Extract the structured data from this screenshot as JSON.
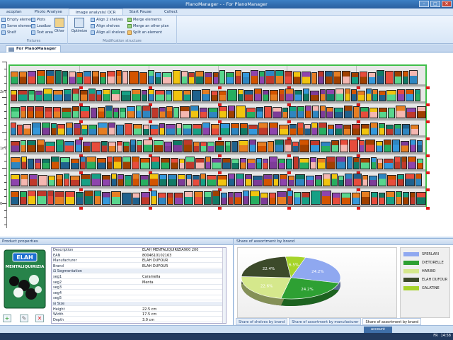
{
  "window": {
    "title": "PlanoManager - - For PlanoManager",
    "btn_min": "–",
    "btn_max": "□",
    "btn_close": "✕"
  },
  "menu_tabs": [
    "acoplan",
    "Photo Analyse",
    "Image analysis/ OCR",
    "Start Pause",
    "Collect"
  ],
  "ribbon": {
    "fixtures": {
      "empty_element": "Empty element",
      "same_element": "Same element",
      "shelf": "Shelf",
      "plots": "Plots",
      "loadbar": "Loadbar",
      "text_area": "Text area",
      "other": "Other",
      "group_label": "Fixtures"
    },
    "modification": {
      "optimize": "Optimize",
      "align_2_shelves": "Align 2 shelves",
      "align_shelves": "Align shelves",
      "align_all_shelves": "Align all shelves",
      "merge_elements": "Merge elements",
      "merge_other_plan": "Merge an other plan",
      "split_element": "Split an element",
      "group_label": "Modification structure"
    }
  },
  "document_tab": "For PlanoManager",
  "ruler": {
    "labels": [
      "2m",
      "1m",
      "0"
    ]
  },
  "product_properties": {
    "title": "Product properties",
    "rows": [
      {
        "key": "Description",
        "value": "ELAH MENTALIQUIRIZIA900  200"
      },
      {
        "key": "EAN",
        "value": "8004610102163"
      },
      {
        "key": "Manufacturer",
        "value": "ELAH DUFOUR"
      },
      {
        "key": "Brand",
        "value": "ELAH DUFOUR"
      },
      {
        "key": "⊟  Segmentation",
        "value": "",
        "category": true
      },
      {
        "key": "seg1",
        "value": "Caramella"
      },
      {
        "key": "seg2",
        "value": "Menta"
      },
      {
        "key": "seg3",
        "value": ""
      },
      {
        "key": "seg4",
        "value": ""
      },
      {
        "key": "seg5",
        "value": ""
      },
      {
        "key": "⊟  Size",
        "value": "",
        "category": true
      },
      {
        "key": "Height",
        "value": "22.5 cm"
      },
      {
        "key": "Width",
        "value": "17.5 cm"
      },
      {
        "key": "Depth",
        "value": "3.0 cm"
      }
    ],
    "pack_brand": "ELAH",
    "pack_name": "MENTALIQUIRIZIA",
    "btn_add": "+",
    "btn_edit": "✎",
    "btn_delete": "✕"
  },
  "share_panel": {
    "title": "Share of assortment by brand",
    "tabs": [
      "Share of shelves by brand",
      "Share of assortment by manufacturer",
      "Share of assortment by brand"
    ],
    "active_tab": 2
  },
  "chart_data": {
    "type": "pie",
    "title": "",
    "slices": [
      {
        "label": "SPERLARI",
        "value": 24.2,
        "color": "#8fa8f0"
      },
      {
        "label": "DIETORELLE",
        "value": 24.2,
        "color": "#2ea033"
      },
      {
        "label": "HARIBO",
        "value": 22.6,
        "color": "#d5e88c"
      },
      {
        "label": "ELAH DUFOUR",
        "value": 22.4,
        "color": "#3c4a2a"
      },
      {
        "label": "GALATINE",
        "value": 6.5,
        "color": "#a6d42a"
      }
    ],
    "data_labels": [
      "24.2%",
      "24.2%",
      "22.6%",
      "22.4%",
      "6.5%"
    ],
    "legend_position": "right"
  },
  "status": {
    "account": "account",
    "lang": "FR",
    "time": "14:58"
  }
}
